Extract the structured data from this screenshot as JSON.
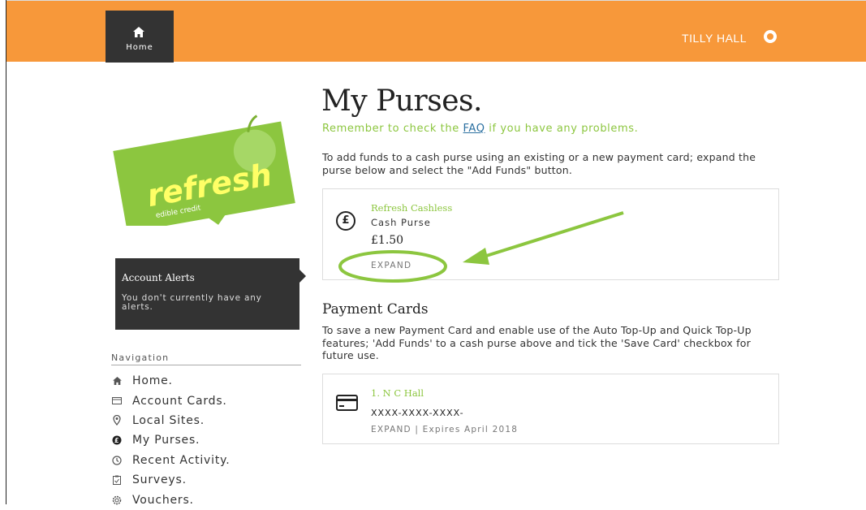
{
  "header": {
    "home_label": "Home",
    "user_name": "TILLY HALL",
    "accent_color": "#f7983a",
    "dark_color": "#333333"
  },
  "brand": {
    "logo_text": "refresh",
    "tagline": "edible credit",
    "card_color": "#8cc63f"
  },
  "alerts": {
    "title": "Account Alerts",
    "message": "You don't currently have any alerts."
  },
  "navigation": {
    "heading": "Navigation",
    "items": [
      {
        "label": "Home.",
        "icon": "home-icon"
      },
      {
        "label": "Account Cards.",
        "icon": "card-icon"
      },
      {
        "label": "Local Sites.",
        "icon": "location-pin-icon"
      },
      {
        "label": "My Purses.",
        "icon": "pound-coin-icon"
      },
      {
        "label": "Recent Activity.",
        "icon": "clock-icon"
      },
      {
        "label": "Surveys.",
        "icon": "clipboard-icon"
      },
      {
        "label": "Vouchers.",
        "icon": "voucher-icon"
      }
    ]
  },
  "main": {
    "title": "My Purses.",
    "subtitle_before": "Remember to check the ",
    "subtitle_link": "FAQ",
    "subtitle_after": " if you have any problems.",
    "instructions": "To add funds to a cash purse using an existing or a new payment card; expand the purse below and select the \"Add Funds\" button."
  },
  "purse": {
    "name": "Refresh Cashless",
    "type": "Cash Purse",
    "balance": "£1.50",
    "expand_label": "EXPAND",
    "icon": "pound-coin-icon"
  },
  "payment_cards": {
    "heading": "Payment Cards",
    "description": "To save a new Payment Card and enable use of the Auto Top-Up and Quick Top-Up features; 'Add Funds' to a cash purse above and tick the 'Save Card' checkbox for future use.",
    "cards": [
      {
        "name": "1. N C Hall",
        "number": "XXXX-XXXX-XXXX-",
        "expand_label": "EXPAND",
        "separator": "|",
        "expires": "Expires April 2018"
      }
    ]
  },
  "annotation": {
    "highlight_color": "#8cc63f"
  }
}
